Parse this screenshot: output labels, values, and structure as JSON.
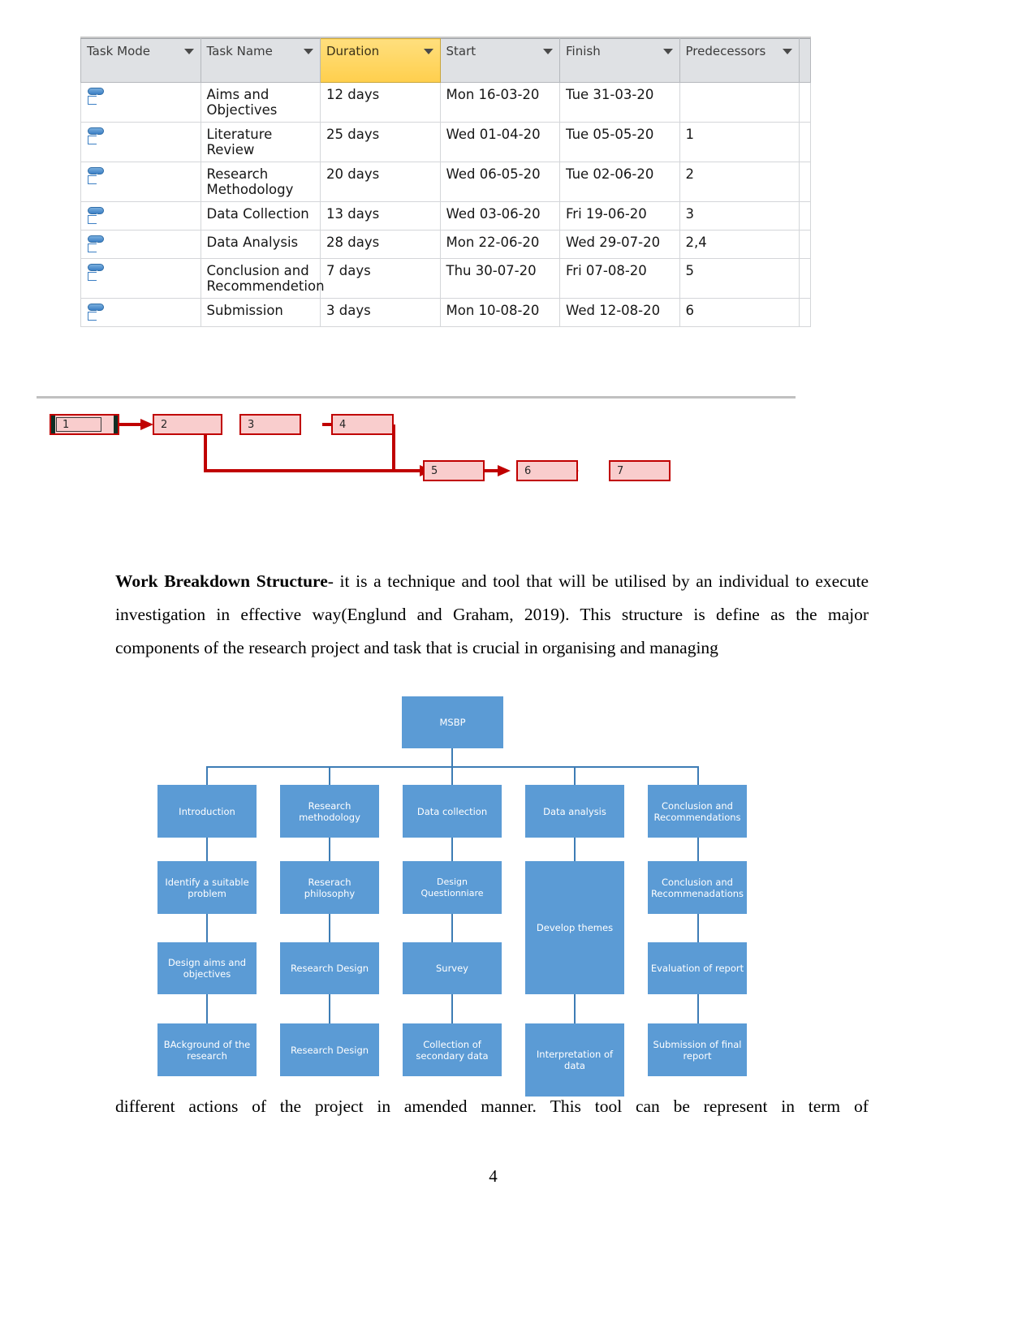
{
  "project_table": {
    "columns": [
      {
        "label": "Task Mode",
        "has_filter": true,
        "highlight": false
      },
      {
        "label": "Task Name",
        "has_filter": true,
        "highlight": false
      },
      {
        "label": "Duration",
        "has_filter": true,
        "highlight": true
      },
      {
        "label": "Start",
        "has_filter": true,
        "highlight": false
      },
      {
        "label": "Finish",
        "has_filter": true,
        "highlight": false
      },
      {
        "label": "Predecessors",
        "has_filter": true,
        "highlight": false
      }
    ],
    "rows": [
      {
        "mode_icon": "auto-schedule-icon",
        "name": "Aims and Objectives",
        "duration": "12 days",
        "start": "Mon 16-03-20",
        "finish": "Tue 31-03-20",
        "predecessors": ""
      },
      {
        "mode_icon": "auto-schedule-icon",
        "name": "Literature Review",
        "duration": "25 days",
        "start": "Wed 01-04-20",
        "finish": "Tue 05-05-20",
        "predecessors": "1"
      },
      {
        "mode_icon": "auto-schedule-icon",
        "name": "Research Methodology",
        "duration": "20 days",
        "start": "Wed 06-05-20",
        "finish": "Tue 02-06-20",
        "predecessors": "2"
      },
      {
        "mode_icon": "auto-schedule-icon",
        "name": "Data Collection",
        "duration": "13 days",
        "start": "Wed 03-06-20",
        "finish": "Fri 19-06-20",
        "predecessors": "3"
      },
      {
        "mode_icon": "auto-schedule-icon",
        "name": "Data Analysis",
        "duration": "28 days",
        "start": "Mon 22-06-20",
        "finish": "Wed 29-07-20",
        "predecessors": "2,4"
      },
      {
        "mode_icon": "auto-schedule-icon",
        "name": "Conclusion and Recommendetion",
        "duration": "7 days",
        "start": "Thu 30-07-20",
        "finish": "Fri 07-08-20",
        "predecessors": "5"
      },
      {
        "mode_icon": "auto-schedule-icon",
        "name": "Submission",
        "duration": "3 days",
        "start": "Mon 10-08-20",
        "finish": "Wed 12-08-20",
        "predecessors": "6"
      }
    ],
    "colors": {
      "header_bg": "#dfe1e4",
      "duration_highlight": "#ffd966",
      "date_column_bg": "#e9f0f8"
    }
  },
  "network_diagram": {
    "nodes": [
      {
        "label": "1",
        "selected": true
      },
      {
        "label": "2",
        "selected": false
      },
      {
        "label": "3",
        "selected": false
      },
      {
        "label": "4",
        "selected": false
      },
      {
        "label": "5",
        "selected": false
      },
      {
        "label": "6",
        "selected": false
      },
      {
        "label": "7",
        "selected": false
      }
    ],
    "colors": {
      "node_fill": "#f9cdcd",
      "node_border": "#c00000",
      "connector": "#c00000",
      "selection": "#0f2e24"
    }
  },
  "paragraph": {
    "heading": "Work Breakdown Structure",
    "body": "- it is a technique and tool that will be utilised by an individual to execute investigation in effective way(Englund and Graham,  2019). This structure is define as the major components of the research project and task that is crucial in organising and managing"
  },
  "bottom_text": {
    "words": [
      "different",
      "actions",
      "of",
      "the",
      "project",
      "in",
      "amended",
      "manner.",
      "This",
      "tool",
      "can",
      "be",
      "represent",
      "in",
      "term",
      "of"
    ]
  },
  "footer": {
    "page_number": "4"
  },
  "wbs": {
    "root": "MSBP",
    "accent_color": "#5b9bd5",
    "connector_color": "#3d7cb5",
    "columns": [
      {
        "name": "introduction-branch",
        "items": [
          "Introduction",
          "Identify a suitable problem",
          "Design aims and objectives",
          "BAckground of the research"
        ]
      },
      {
        "name": "research-methodology-branch",
        "items": [
          "Research methodology",
          "Reserach philosophy",
          "Research Design",
          "Research Design"
        ]
      },
      {
        "name": "data-collection-branch",
        "items": [
          "Data collection",
          "Design Questionniare",
          "Survey",
          "Collection of secondary data"
        ]
      },
      {
        "name": "data-analysis-branch",
        "items": [
          "Data analysis",
          "Develop themes",
          "Interpretation of data"
        ]
      },
      {
        "name": "conclusion-branch",
        "items": [
          "Conclusion and Recommendations",
          "Conclusion and Recommenadations",
          "Evaluation of report",
          "Submission of final report"
        ]
      }
    ]
  }
}
